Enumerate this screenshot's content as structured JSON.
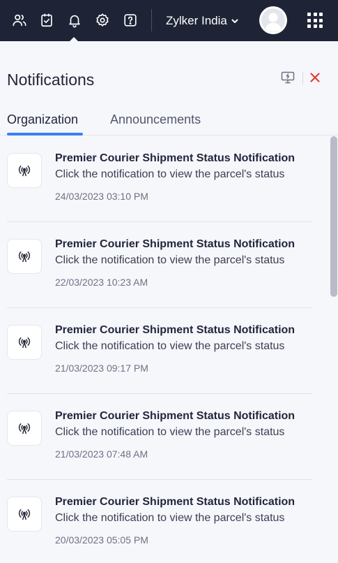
{
  "topbar": {
    "icons": [
      "users-icon",
      "tasks-icon",
      "bell-icon",
      "settings-icon",
      "help-icon"
    ],
    "organization": "Zylker India",
    "colors": {
      "background": "#1e2436"
    }
  },
  "panel": {
    "title": "Notifications",
    "actions": [
      "monitor-icon",
      "close-icon"
    ],
    "tabs": [
      {
        "label": "Organization",
        "active": true
      },
      {
        "label": "Announcements",
        "active": false
      }
    ],
    "accent_color": "#3b82f6",
    "close_color": "#e53935"
  },
  "notifications": [
    {
      "title": "Premier Courier Shipment Status Notification",
      "description": "Click the notification to view the parcel's status",
      "timestamp": "24/03/2023 03:10 PM",
      "icon": "broadcast-icon"
    },
    {
      "title": "Premier Courier Shipment Status Notification",
      "description": "Click the notification to view the parcel's status",
      "timestamp": "22/03/2023 10:23 AM",
      "icon": "broadcast-icon"
    },
    {
      "title": "Premier Courier Shipment Status Notification",
      "description": "Click the notification to view the parcel's status",
      "timestamp": "21/03/2023 09:17 PM",
      "icon": "broadcast-icon"
    },
    {
      "title": "Premier Courier Shipment Status Notification",
      "description": "Click the notification to view the parcel's status",
      "timestamp": "21/03/2023 07:48 AM",
      "icon": "broadcast-icon"
    },
    {
      "title": "Premier Courier Shipment Status Notification",
      "description": "Click the notification to view the parcel's status",
      "timestamp": "20/03/2023 05:05 PM",
      "icon": "broadcast-icon"
    }
  ]
}
